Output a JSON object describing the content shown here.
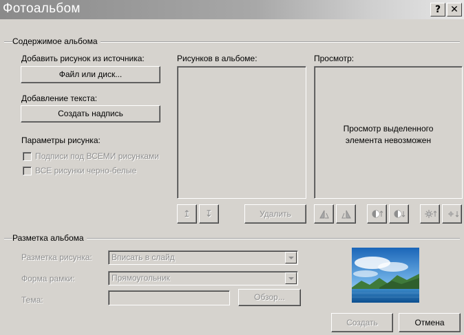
{
  "window": {
    "title": "Фотоальбом",
    "help_label": "?",
    "close_label": "✕"
  },
  "album_content": {
    "group_label": "Содержимое альбома",
    "add_picture_label": "Добавить рисунок из источника:",
    "file_button": "Файл или диск...",
    "add_text_label": "Добавление текста:",
    "caption_button": "Создать надпись",
    "picture_params_label": "Параметры рисунка:",
    "captions_checkbox": "Подписи под ВСЕМИ рисунками",
    "bw_checkbox": "ВСЕ рисунки черно-белые",
    "pictures_label": "Рисунков в альбоме:",
    "move_up_label": "↥",
    "move_down_label": "↧",
    "delete_button": "Удалить",
    "preview_label": "Просмотр:",
    "preview_message_line1": "Просмотр выделенного",
    "preview_message_line2": "элемента невозможен"
  },
  "album_layout": {
    "group_label": "Разметка альбома",
    "picture_layout_label": "Разметка рисунка:",
    "picture_layout_value": "Вписать в слайд",
    "frame_shape_label": "Форма рамки:",
    "frame_shape_value": "Прямоугольник",
    "theme_label": "Тема:",
    "theme_value": "",
    "browse_button": "Обзор..."
  },
  "footer": {
    "create_button": "Создать",
    "cancel_button": "Отмена"
  },
  "colors": {
    "dialog_bg": "#d6d3ce",
    "disabled_text": "#8e8e8e"
  }
}
